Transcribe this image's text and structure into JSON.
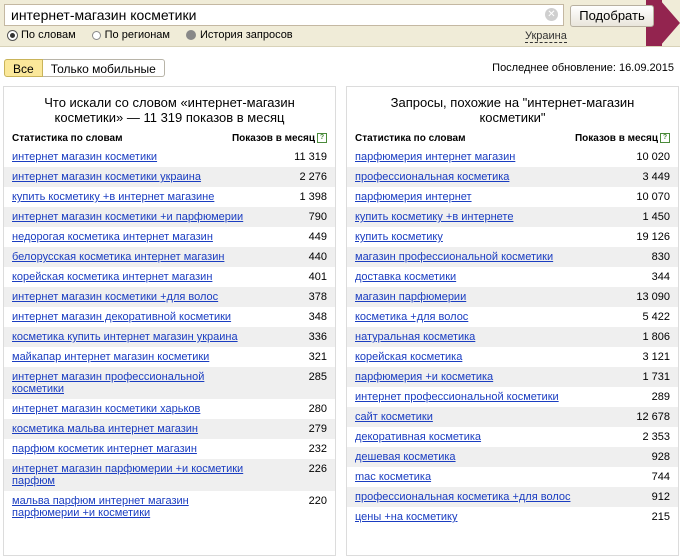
{
  "search": {
    "value": "интернет-магазин косметики",
    "button": "Подобрать"
  },
  "radios": [
    {
      "label": "По словам",
      "checked": true
    },
    {
      "label": "По регионам",
      "checked": false
    },
    {
      "label": "История запросов",
      "checked": false
    }
  ],
  "region": "Украина",
  "tabs": {
    "all": "Все",
    "mobile": "Только мобильные"
  },
  "last_update": "Последнее обновление:  16.09.2015",
  "left": {
    "title_prefix": "Что искали со словом «интернет-магазин косметики» — ",
    "title_count": "11 319",
    "title_suffix": " показов в месяц",
    "col_query": "Статистика по словам",
    "col_count": "Показов в месяц",
    "rows": [
      {
        "q": "интернет магазин косметики",
        "c": "11 319"
      },
      {
        "q": "интернет магазин косметики украина",
        "c": "2 276"
      },
      {
        "q": "купить косметику +в интернет магазине",
        "c": "1 398"
      },
      {
        "q": "интернет магазин косметики +и парфюмерии",
        "c": "790"
      },
      {
        "q": "недорогая косметика интернет магазин",
        "c": "449"
      },
      {
        "q": "белорусская косметика интернет магазин",
        "c": "440"
      },
      {
        "q": "корейская косметика интернет магазин",
        "c": "401"
      },
      {
        "q": "интернет магазин косметики +для волос",
        "c": "378"
      },
      {
        "q": "интернет магазин декоративной косметики",
        "c": "348"
      },
      {
        "q": "косметика купить интернет магазин украина",
        "c": "336"
      },
      {
        "q": "майкапар интернет магазин косметики",
        "c": "321"
      },
      {
        "q": "интернет магазин профессиональной косметики",
        "c": "285"
      },
      {
        "q": "интернет магазин косметики харьков",
        "c": "280"
      },
      {
        "q": "косметика мальва интернет магазин",
        "c": "279"
      },
      {
        "q": "парфюм косметик интернет магазин",
        "c": "232"
      },
      {
        "q": "интернет магазин парфюмерии +и косметики парфюм",
        "c": "226"
      },
      {
        "q": "мальва парфюм интернет магазин парфюмерии +и косметики",
        "c": "220"
      }
    ]
  },
  "right": {
    "title": "Запросы, похожие на \"интернет-магазин косметики\"",
    "col_query": "Статистика по словам",
    "col_count": "Показов в месяц",
    "rows": [
      {
        "q": "парфюмерия интернет магазин",
        "c": "10 020"
      },
      {
        "q": "профессиональная косметика",
        "c": "3 449"
      },
      {
        "q": "парфюмерия интернет",
        "c": "10 070"
      },
      {
        "q": "купить косметику +в интернете",
        "c": "1 450"
      },
      {
        "q": "купить косметику",
        "c": "19 126"
      },
      {
        "q": "магазин профессиональной косметики",
        "c": "830"
      },
      {
        "q": "доставка косметики",
        "c": "344"
      },
      {
        "q": "магазин парфюмерии",
        "c": "13 090"
      },
      {
        "q": "косметика +для волос",
        "c": "5 422"
      },
      {
        "q": "натуральная косметика",
        "c": "1 806"
      },
      {
        "q": "корейская косметика",
        "c": "3 121"
      },
      {
        "q": "парфюмерия +и косметика",
        "c": "1 731"
      },
      {
        "q": "интернет профессиональной косметики",
        "c": "289"
      },
      {
        "q": "сайт косметики",
        "c": "12 678"
      },
      {
        "q": "декоративная косметика",
        "c": "2 353"
      },
      {
        "q": "дешевая косметика",
        "c": "928"
      },
      {
        "q": "mac косметика",
        "c": "744"
      },
      {
        "q": "профессиональная косметика +для волос",
        "c": "912"
      },
      {
        "q": "цены +на косметику",
        "c": "215"
      }
    ]
  }
}
